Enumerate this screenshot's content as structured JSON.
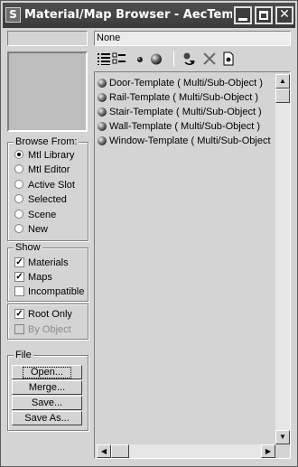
{
  "window": {
    "title": "Material/Map Browser - AecTempla...",
    "app_icon": "S"
  },
  "name_field": {
    "value": "None"
  },
  "browse_from": {
    "title": "Browse From:",
    "options": [
      {
        "label": "Mtl Library",
        "selected": true
      },
      {
        "label": "Mtl Editor",
        "selected": false
      },
      {
        "label": "Active Slot",
        "selected": false
      },
      {
        "label": "Selected",
        "selected": false
      },
      {
        "label": "Scene",
        "selected": false
      },
      {
        "label": "New",
        "selected": false
      }
    ]
  },
  "show": {
    "title": "Show",
    "options": [
      {
        "label": "Materials",
        "checked": true
      },
      {
        "label": "Maps",
        "checked": true
      },
      {
        "label": "Incompatible",
        "checked": false
      }
    ]
  },
  "root": {
    "options": [
      {
        "label": "Root Only",
        "checked": true,
        "disabled": false
      },
      {
        "label": "By Object",
        "checked": false,
        "disabled": true
      }
    ]
  },
  "file": {
    "title": "File",
    "buttons": [
      "Open...",
      "Merge...",
      "Save...",
      "Save As..."
    ]
  },
  "toolbar_icons": [
    "list-view-icon",
    "list-icons-view-icon",
    "small-icons-view-icon",
    "large-icons-view-icon",
    "update-scene-materials-icon",
    "delete-from-library-icon",
    "clear-library-icon"
  ],
  "materials": [
    "Door-Template  ( Multi/Sub-Object )",
    "Rail-Template  ( Multi/Sub-Object )",
    "Stair-Template  ( Multi/Sub-Object )",
    "Wall-Template  ( Multi/Sub-Object )",
    "Window-Template  ( Multi/Sub-Object"
  ],
  "colors": {
    "title_bar": "#3a3a3a",
    "window_bg": "#d4d4d4",
    "field_bg": "#ececec"
  }
}
